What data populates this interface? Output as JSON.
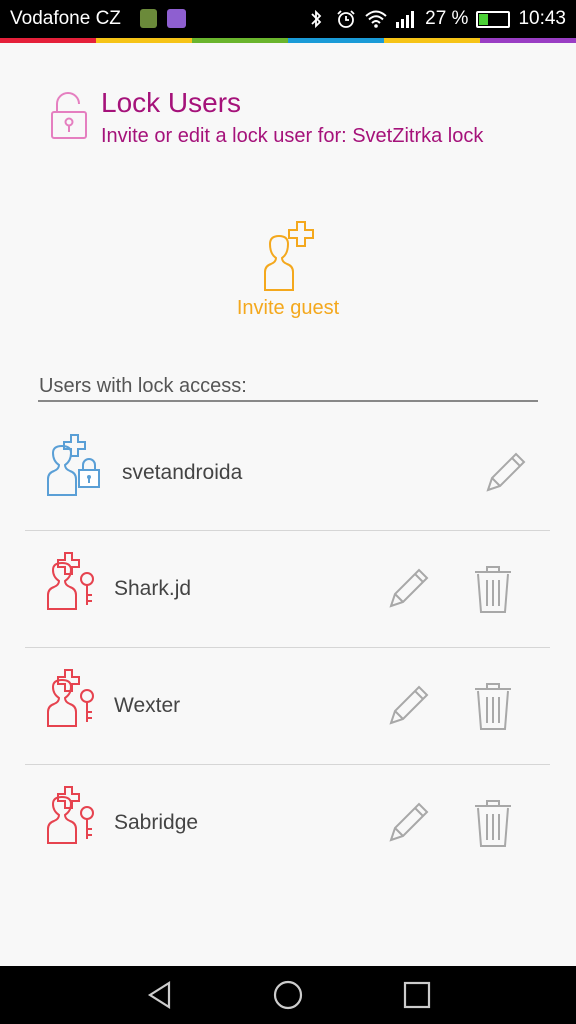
{
  "status_bar": {
    "carrier": "Vodafone CZ",
    "battery": "27 %",
    "time": "10:43"
  },
  "color_strip": [
    "#e5203a",
    "#f6c417",
    "#6ab52d",
    "#1a9bd7",
    "#f6c417",
    "#9a3ec4"
  ],
  "header": {
    "title": "Lock Users",
    "subtitle": "Invite or edit a lock user for: SvetZitrka lock",
    "icon": "padlock-icon"
  },
  "invite": {
    "label": "Invite guest",
    "icon": "add-user-icon"
  },
  "section_label": "Users with lock access:",
  "users": [
    {
      "name": "svetandroida",
      "type": "owner",
      "icon_color": "#5a9fd6",
      "can_delete": false
    },
    {
      "name": "Shark.jd",
      "type": "guest",
      "icon_color": "#e6434f",
      "can_delete": true
    },
    {
      "name": "Wexter",
      "type": "guest",
      "icon_color": "#e6434f",
      "can_delete": true
    },
    {
      "name": "Sabridge",
      "type": "guest",
      "icon_color": "#e6434f",
      "can_delete": true
    }
  ],
  "colors": {
    "accent": "#a5127a",
    "invite": "#f4a81d",
    "owner": "#5a9fd6",
    "guest": "#e6434f"
  }
}
